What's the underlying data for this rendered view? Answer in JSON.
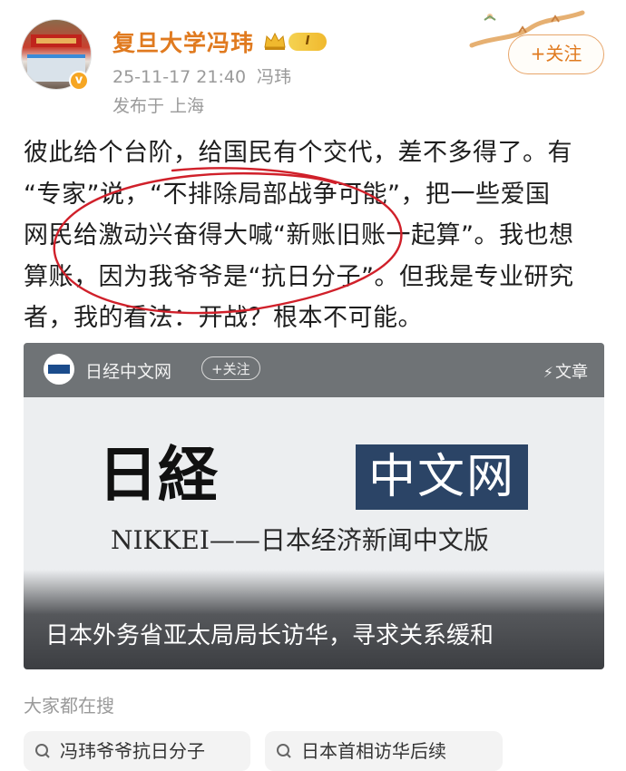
{
  "header": {
    "name": "复旦大学冯玮",
    "level": "I",
    "timestamp": "25-11-17 21:40",
    "author_short": "冯玮",
    "location": "发布于 上海",
    "follow_label": "+关注",
    "verified_mark": "v"
  },
  "post": {
    "lines": [
      "彼此给个台阶，给国民有个交代，差不多得了。有",
      "“专家”说，“不排除局部战争可能”，把一些爱国",
      "网民给激动兴奋得大喊“新账旧账一起算”。我也想",
      "算账，因为我爷爷是“抗日分子”。但我是专业研究",
      "者，我的看法：开战？根本不可能。"
    ]
  },
  "card": {
    "source": "日经中文网",
    "follow_label": "+关注",
    "tag": "文章",
    "tag_icon": "⚡",
    "logo_calligraphy": "日経",
    "logo_box": "中文网",
    "logo_sub": "NIKKEI——日本经济新闻中文版",
    "title": "日本外务省亚太局局长访华，寻求关系缓和"
  },
  "search": {
    "label": "大家都在搜",
    "items": [
      "冯玮爷爷抗日分子",
      "日本首相访华后续"
    ]
  },
  "colors": {
    "accent": "#e07a1f",
    "annotation_red": "#d0202a",
    "card_dark": "#3c3e42"
  }
}
